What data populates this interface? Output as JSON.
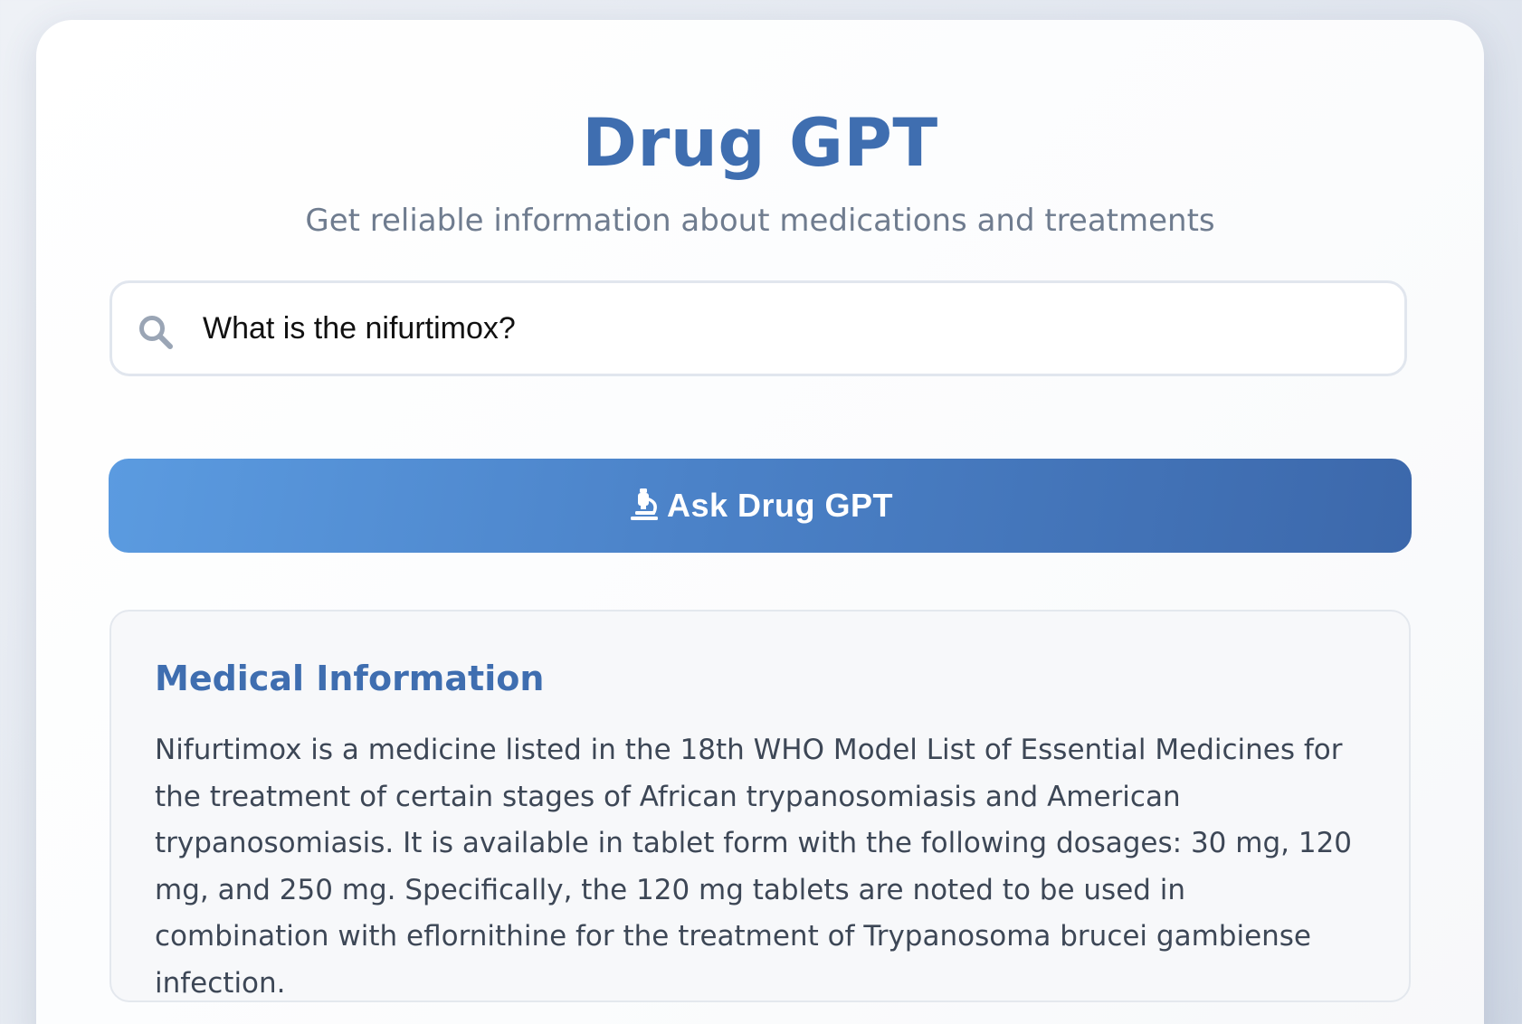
{
  "app": {
    "title": "Drug GPT",
    "subtitle": "Get reliable information about medications and treatments"
  },
  "search": {
    "icon": "search-icon",
    "value": "What is the nifurtimox?"
  },
  "ask_button": {
    "icon": "microscope-icon",
    "label": "Ask Drug GPT"
  },
  "result": {
    "heading": "Medical Information",
    "body": "Nifurtimox is a medicine listed in the 18th WHO Model List of Essential Medicines for the treatment of certain stages of African trypanosomiasis and American trypanosomiasis. It is available in tablet form with the following dosages: 30 mg, 120 mg, and 250 mg. Specifically, the 120 mg tablets are noted to be used in combination with eflornithine for the treatment of Trypanosoma brucei gambiense infection."
  },
  "colors": {
    "brand": "#3f6eb0",
    "button_start": "#5b9be0",
    "button_end": "#3c68ab",
    "subtitle": "#6f7c8f",
    "body_text": "#3d4756"
  }
}
